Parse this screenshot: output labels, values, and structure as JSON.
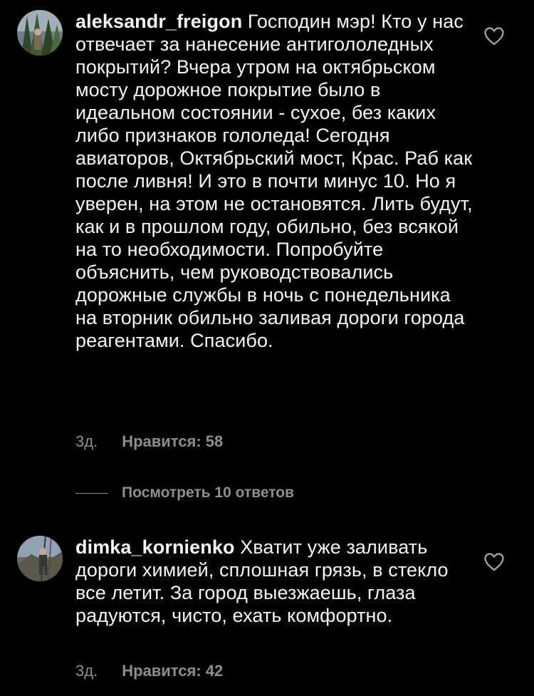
{
  "comments": [
    {
      "username": "aleksandr_freigon",
      "text": "Господин мэр! Кто у нас отвечает за нанесение антигололедных покрытий? Вчера утром на октябрьском мосту дорожное покрытие было в идеальном состоянии - сухое, без каких либо признаков гололеда! Сегодня авиаторов, Октябрьский мост, Крас. Раб как после ливня! И это в почти минус 10.  Но я уверен, на этом не остановятся. Лить будут, как и в прошлом году, обильно, без всякой на то необходимости. Попробуйте объяснить, чем руководствовались дорожные службы в ночь с понедельника на вторник обильно заливая дороги города реагентами. Спасибо.",
      "time": "3д.",
      "likes": "Нравится: 58",
      "avatar_icon": "avatar-forest-photo",
      "like_icon": "heart-outline-icon"
    },
    {
      "username": "dimka_kornienko",
      "text": "Хватит уже заливать дороги химией, сплошная грязь, в стекло все летит. За город выезжаешь, глаза радуются, чисто, ехать комфортно.",
      "time": "3д.",
      "likes": "Нравится: 42",
      "avatar_icon": "avatar-climber-photo",
      "like_icon": "heart-outline-icon"
    }
  ],
  "replies_link": "Посмотреть 10 ответов",
  "colors": {
    "background": "#000000",
    "text": "#f5f5f5",
    "secondary": "#8e8e8e"
  }
}
